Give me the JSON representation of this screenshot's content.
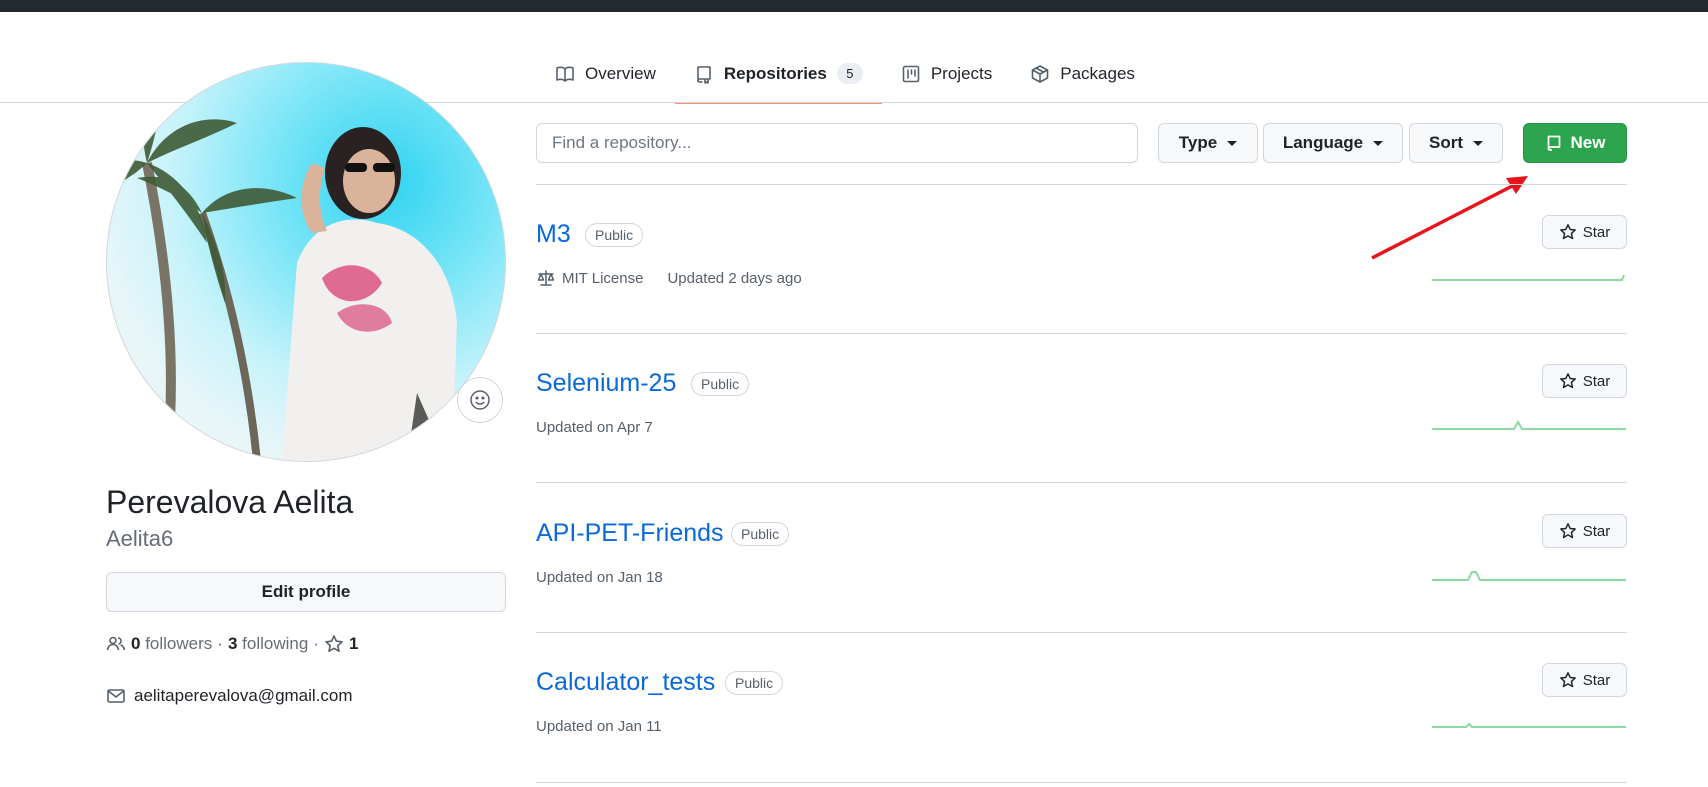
{
  "tabs": [
    {
      "label": "Overview",
      "icon": "book-icon"
    },
    {
      "label": "Repositories",
      "icon": "repo-icon",
      "count": "5",
      "active": true
    },
    {
      "label": "Projects",
      "icon": "project-icon"
    },
    {
      "label": "Packages",
      "icon": "package-icon"
    }
  ],
  "profile": {
    "full_name": "Perevalova Aelita",
    "username": "Aelita6",
    "edit_label": "Edit profile",
    "followers_count": "0",
    "followers_label": "followers",
    "following_count": "3",
    "following_label": "following",
    "stars_count": "1",
    "email": "aelitaperevalova@gmail.com"
  },
  "filter": {
    "search_placeholder": "Find a repository...",
    "type_label": "Type",
    "language_label": "Language",
    "sort_label": "Sort",
    "new_label": "New"
  },
  "repos": [
    {
      "name": "M3",
      "visibility": "Public",
      "license": "MIT License",
      "updated": "Updated 2 days ago",
      "star_label": "Star"
    },
    {
      "name": "Selenium-25",
      "visibility": "Public",
      "updated": "Updated on Apr 7",
      "star_label": "Star"
    },
    {
      "name": "API-PET-Friends",
      "visibility": "Public",
      "updated": "Updated on Jan 18",
      "star_label": "Star"
    },
    {
      "name": "Calculator_tests",
      "visibility": "Public",
      "updated": "Updated on Jan 11",
      "star_label": "Star"
    }
  ],
  "colors": {
    "link": "#0969da",
    "primary_button": "#2da44e",
    "active_tab_underline": "#fd8c73",
    "annotation_arrow": "#e8131b",
    "sparkline": "#8cdaa0"
  }
}
